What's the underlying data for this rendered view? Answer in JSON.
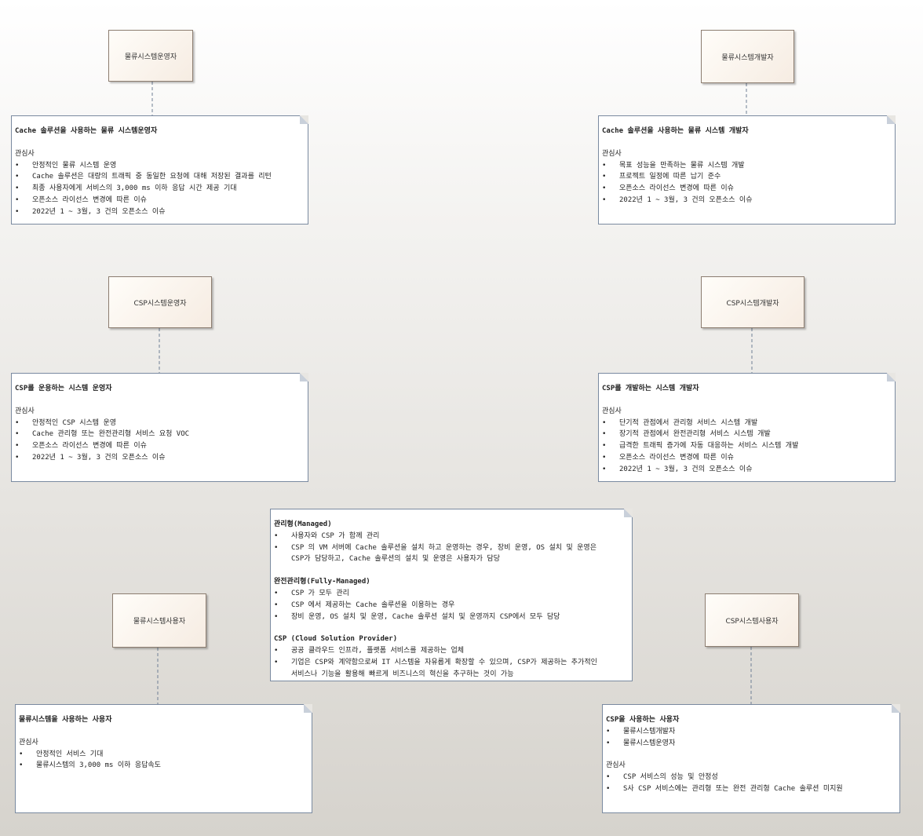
{
  "actors": {
    "logistics_ops": "물류시스템운영자",
    "logistics_dev": "물류시스템개발자",
    "csp_ops": "CSP시스템운영자",
    "csp_dev": "CSP시스템개발자",
    "logistics_user": "물류시스템사용자",
    "csp_user": "CSP시스템사용자"
  },
  "notes": {
    "logistics_ops": {
      "title": "Cache 솔루션을 사용하는 물류 시스템운영자",
      "heading": "관심사",
      "items": [
        "안정적인 물류 시스템 운영",
        "Cache 솔루션은 대량의 트래픽 중 동일한 요청에 대해 저장된 결과를 리턴",
        "최종 사용자에게 서비스의 3,000 ms 이하 응답 시간 제공 기대",
        "오픈소스 라이선스 변경에 따른 이슈",
        "2022년 1 ~ 3월, 3 건의 오픈소스 이슈"
      ]
    },
    "logistics_dev": {
      "title": "Cache 솔루션을 사용하는 물류 시스템 개발자",
      "heading": "관심사",
      "items": [
        "목표 성능을 만족하는 물류 시스템 개발",
        "프로젝트 일정에 따른 납기 준수",
        "오픈소스 라이선스 변경에 따른 이슈",
        "2022년 1 ~ 3월, 3 건의 오픈소스 이슈"
      ]
    },
    "csp_ops": {
      "title": "CSP를 운용하는 시스템 운영자",
      "heading": "관심사",
      "items": [
        "안정적인 CSP 시스템 운영",
        "Cache 관리형 또는 완전관리형 서비스 요청 VOC",
        "오픈소스 라이선스 변경에 따른 이슈",
        "2022년 1 ~ 3월, 3 건의 오픈소스 이슈"
      ]
    },
    "csp_dev": {
      "title": "CSP를 개발하는 시스템 개발자",
      "heading": "관심사",
      "items": [
        "단기적 관점에서 관리형 서비스 시스템 개발",
        "장기적 관점에서 완전관리형 서비스 시스템 개발",
        "급격한 트래픽 증가에 자동 대응하는 서비스 시스템 개발",
        "오픈소스 라이선스 변경에 따른 이슈",
        "2022년 1 ~ 3월, 3 건의 오픈소스 이슈"
      ]
    },
    "definitions": {
      "managed_title": "관리형(Managed)",
      "managed_items": [
        "사용자와 CSP 가 함께 관리",
        "CSP 의 VM 서버에 Cache 솔루션을 설치 하고 운영하는 경우, 장비 운영, OS 설치 및 운영은",
        "CSP가 담당하고, Cache 솔루션의 설치 및 운영은 사용자가 담당"
      ],
      "fully_title": "완전관리형(Fully-Managed)",
      "fully_items": [
        "CSP 가 모두 관리",
        "CSP 에서 제공하는 Cache 솔루션을 이용하는 경우",
        "장비 운영, OS 설치 및 운영, Cache 솔루션 설치 및 운영까지 CSP에서 모두 담당"
      ],
      "csp_title": "CSP (Cloud Solution Provider)",
      "csp_items": [
        "공공 클라우드 인프라, 플랫폼 서비스를 제공하는 업체",
        "기업은 CSP와 계약함으로써 IT 시스템을 자유롭게 확장할 수 있으며, CSP가 제공하는 추가적인",
        "서비스나 기능을 활용해 빠르게 비즈니스의 혁신을 추구하는 것이 가능"
      ]
    },
    "logistics_user": {
      "title": "물류시스템을 사용하는 사용자",
      "heading": "관심사",
      "items": [
        "안정적인 서비스 기대",
        "물류시스템의 3,000 ms 이하 응답속도"
      ]
    },
    "csp_user": {
      "title": "CSP을 사용하는 사용자",
      "users": [
        "물류시스템개발자",
        "물류시스템운영자"
      ],
      "heading": "관심사",
      "items": [
        "CSP 서비스의 성능 및 안정성",
        "S사 CSP 서비스에는 관리형 또는 완전 관리형 Cache 솔루션 미지원"
      ]
    }
  }
}
